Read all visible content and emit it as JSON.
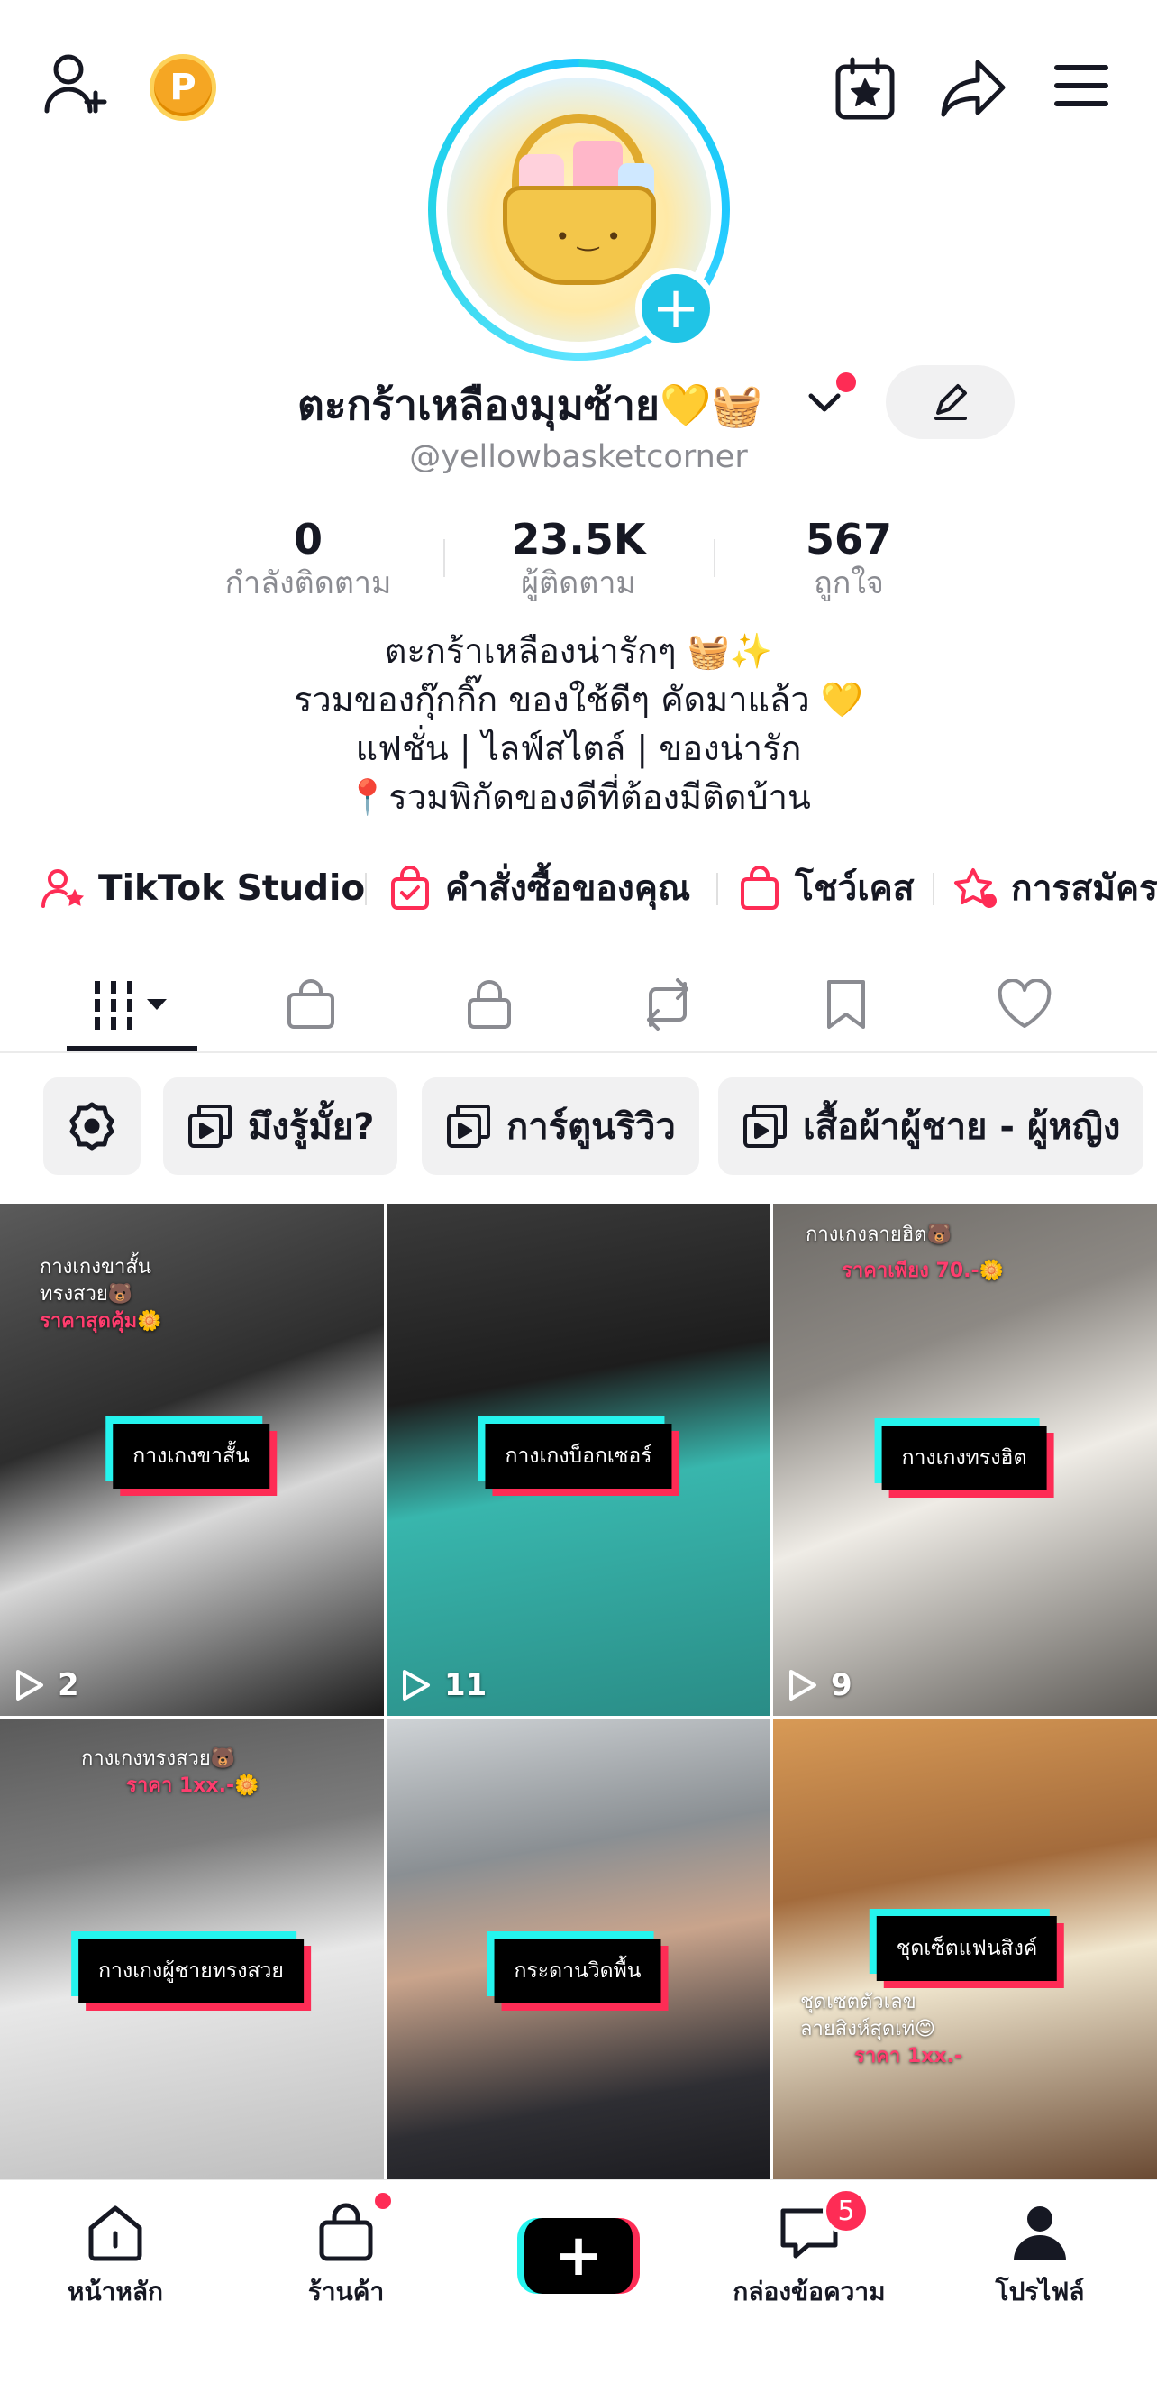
{
  "profile": {
    "name": "ตะกร้าเหลืองมุมซ้าย💛🧺",
    "handle": "@yellowbasketcorner",
    "stats": [
      {
        "value": "0",
        "label": "กำลังติดตาม"
      },
      {
        "value": "23.5K",
        "label": "ผู้ติดตาม"
      },
      {
        "value": "567",
        "label": "ถูกใจ"
      }
    ],
    "bio": [
      "ตะกร้าเหลืองน่ารักๆ 🧺✨",
      "รวมของกุ๊กกิ๊ก ของใช้ดีๆ คัดมาแล้ว 💛",
      "แฟชั่น | ไลฟ์สไตล์ | ของน่ารัก",
      "📍รวมพิกัดของดีที่ต้องมีติดบ้าน"
    ]
  },
  "topbar": {
    "coin_label": "P",
    "icons": [
      "add-friend-icon",
      "coin-icon",
      "calendar-star-icon",
      "share-icon",
      "menu-icon"
    ]
  },
  "links": [
    {
      "label": "TikTok Studio",
      "icon": "studio-icon"
    },
    {
      "label": "คำสั่งซื้อของคุณ",
      "icon": "order-bag-icon"
    },
    {
      "label": "โชว์เคส",
      "icon": "showcase-bag-icon"
    },
    {
      "label": "การสมัคร",
      "icon": "subscription-icon"
    }
  ],
  "tabs": [
    "videos-grid-icon",
    "shop-bag-icon",
    "lock-icon",
    "repost-icon",
    "bookmark-icon",
    "heart-icon"
  ],
  "playlists": [
    {
      "label": "",
      "icon": "settings-icon"
    },
    {
      "label": "มึงรู้มั้ย?",
      "icon": "playlist-icon"
    },
    {
      "label": "การ์ตูนริวิว",
      "icon": "playlist-icon"
    },
    {
      "label": "เสื้อผ้าผู้ชาย - ผู้หญิง",
      "icon": "playlist-icon"
    }
  ],
  "videos": [
    {
      "label": "กางเกงขาสั้น",
      "caption": "กางเกงขาสั้น\nทรงสวย🐻",
      "price": "ราคาสุดคุ้ม🌼",
      "views": "2",
      "bg": "#3a3a3a"
    },
    {
      "label": "กางเกงบ็อกเซอร์",
      "caption": "",
      "price": "",
      "views": "11",
      "bg": "#2e6f6e"
    },
    {
      "label": "กางเกงทรงฮิต",
      "caption": "กางเกงลายฮิต🐻",
      "price": "ราคาเพียง 70.-🌼",
      "views": "9",
      "bg": "#7a7773"
    },
    {
      "label": "กางเกงผู้ชายทรงสวย",
      "caption": "กางเกงทรงสวย🐻",
      "price": "ราคา 1xx.-🌼",
      "views": "",
      "bg": "#6d6d6d"
    },
    {
      "label": "กระดานวิดพื้น",
      "caption": "",
      "price": "",
      "views": "",
      "bg": "#4b4b52"
    },
    {
      "label": "ชุดเซ็ตแฟนสิงค์",
      "caption": "ชุดเซตตัวเลข\nลายสิงห์สุดเท่😊",
      "price": "ราคา 1xx.-",
      "views": "",
      "bg": "#a36b3c"
    }
  ],
  "bottom_nav": [
    {
      "label": "หน้าหลัก",
      "icon": "home-icon"
    },
    {
      "label": "ร้านค้า",
      "icon": "shop-icon"
    },
    {
      "label": "",
      "icon": "create-icon"
    },
    {
      "label": "กล่องข้อความ",
      "icon": "inbox-icon",
      "badge": "5"
    },
    {
      "label": "โปรไฟล์",
      "icon": "profile-icon"
    }
  ],
  "colors": {
    "accent_red": "#fe2c55",
    "accent_cyan": "#25f4ee",
    "ring": "#20c4e6"
  }
}
